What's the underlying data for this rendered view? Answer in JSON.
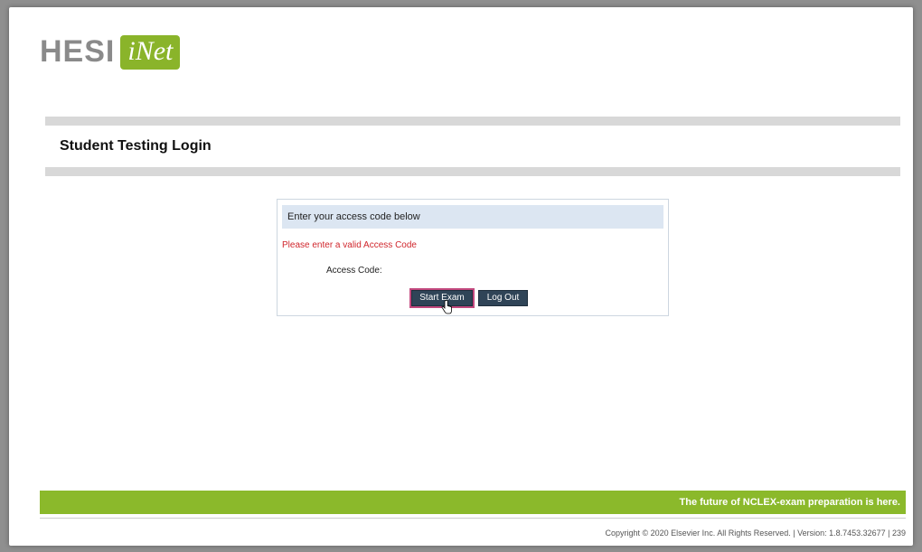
{
  "header": {
    "logo_main": "HESI",
    "logo_badge": "iNet"
  },
  "page": {
    "title": "Student Testing Login"
  },
  "login": {
    "instruction": "Enter your access code below",
    "error": "Please enter a valid Access Code",
    "access_code_label": "Access Code:",
    "access_code_value": "",
    "start_button": "Start Exam",
    "logout_button": "Log Out"
  },
  "banner": {
    "tagline": "The future of NCLEX-exam preparation is here."
  },
  "footer": {
    "copyright": "Copyright © 2020 Elsevier Inc. All Rights Reserved. | Version: 1.8.7453.32677 | 239"
  },
  "colors": {
    "brand_green": "#8bb92b",
    "error_red": "#d0262c",
    "button_bg": "#2f4457"
  }
}
